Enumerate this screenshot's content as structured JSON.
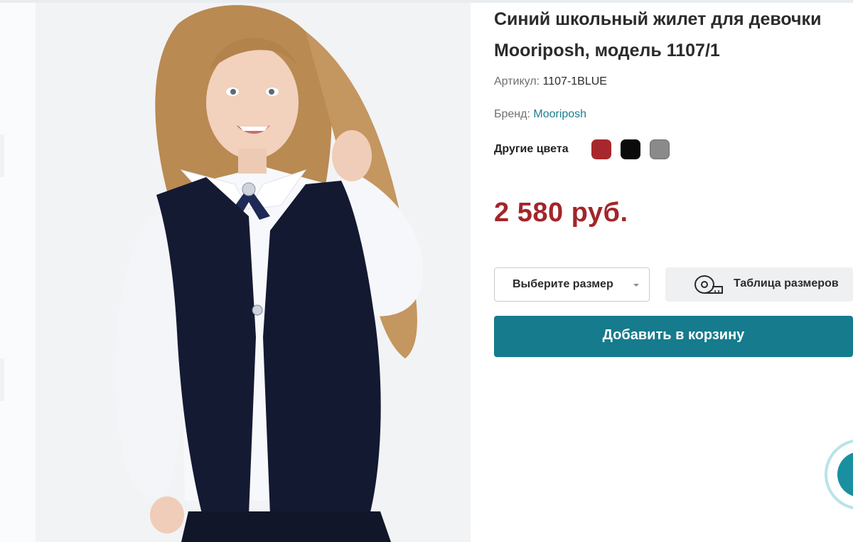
{
  "product": {
    "title_line1": "Синий школьный жилет для девочки",
    "title_line2": "Mooriposh, модель 1107/1",
    "sku_label": "Артикул:",
    "sku_value": "1107-1BLUE",
    "brand_label": "Бренд:",
    "brand_value": "Mooriposh",
    "other_colors_label": "Другие цвета",
    "colors": [
      {
        "name": "red",
        "hex": "#a7282c"
      },
      {
        "name": "black",
        "hex": "#0b0b0b"
      },
      {
        "name": "gray",
        "hex": "#8a8a8a"
      }
    ],
    "price": "2 580 руб."
  },
  "actions": {
    "size_select_label": "Выберите размер",
    "size_table_label": "Таблица размеров",
    "add_to_cart_label": "Добавить в корзину"
  },
  "icons": {
    "zoom": "magnifier-icon",
    "size_table": "measuring-tape-icon",
    "chat": "chat-widget-icon"
  },
  "theme": {
    "accent": "#157b8d",
    "price_color": "#a2262a",
    "link_color": "#1b7f8f"
  }
}
